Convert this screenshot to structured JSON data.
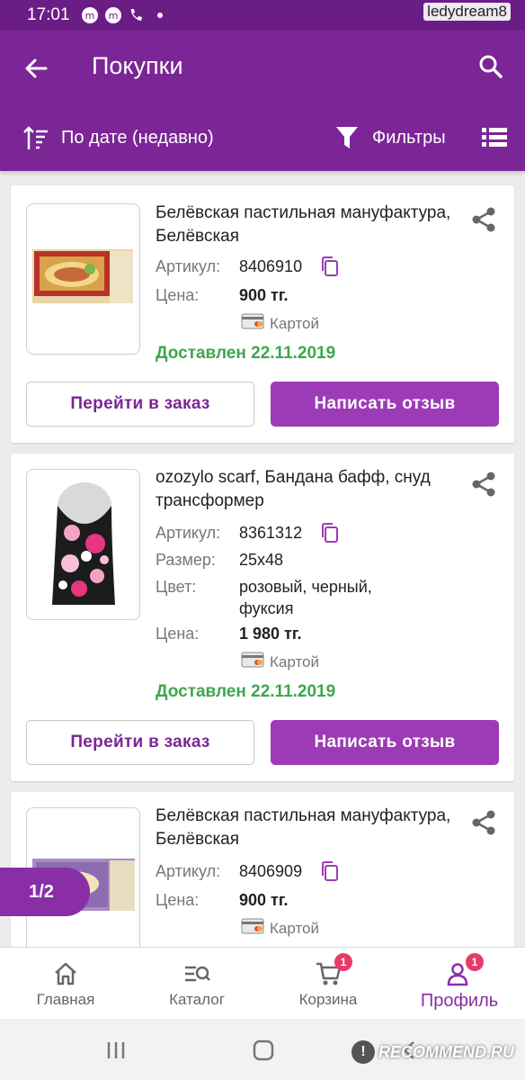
{
  "status_bar": {
    "time": "17:01"
  },
  "watermark_user": "ledydream8",
  "appbar": {
    "title": "Покупки"
  },
  "toolbar": {
    "sort_label": "По дате (недавно)",
    "filter_label": "Фильтры"
  },
  "orders": [
    {
      "name": "Белёвская пастильная мануфактура, Белёвская",
      "article_label": "Артикул:",
      "article": "8406910",
      "price_label": "Цена:",
      "price": "900 тг.",
      "payment": "Картой",
      "status": "Доставлен 22.11.2019",
      "btn_order": "Перейти в заказ",
      "btn_review": "Написать отзыв"
    },
    {
      "name": "ozozylo scarf, Бандана бафф, снуд трансформер",
      "article_label": "Артикул:",
      "article": "8361312",
      "size_label": "Размер:",
      "size": "25x48",
      "color_label": "Цвет:",
      "color": "розовый, черный, фуксия",
      "price_label": "Цена:",
      "price": "1 980 тг.",
      "payment": "Картой",
      "status": "Доставлен 22.11.2019",
      "btn_order": "Перейти в заказ",
      "btn_review": "Написать отзыв"
    },
    {
      "name": "Белёвская пастильная мануфактура, Белёвская",
      "article_label": "Артикул:",
      "article": "8406909",
      "price_label": "Цена:",
      "price": "900 тг.",
      "payment": "Картой"
    }
  ],
  "pager": "1/2",
  "bottom_nav": [
    {
      "label": "Главная",
      "icon": "home-icon"
    },
    {
      "label": "Каталог",
      "icon": "catalog-search-icon"
    },
    {
      "label": "Корзина",
      "icon": "cart-icon",
      "badge": "1"
    },
    {
      "label": "Профиль",
      "icon": "profile-icon",
      "badge": "1",
      "active": true
    }
  ],
  "watermark_site": "RECOMMEND.RU",
  "colors": {
    "primary": "#7b2596",
    "button": "#9d3bb7",
    "delivered": "#3ea64d",
    "badge": "#e53d6a"
  }
}
